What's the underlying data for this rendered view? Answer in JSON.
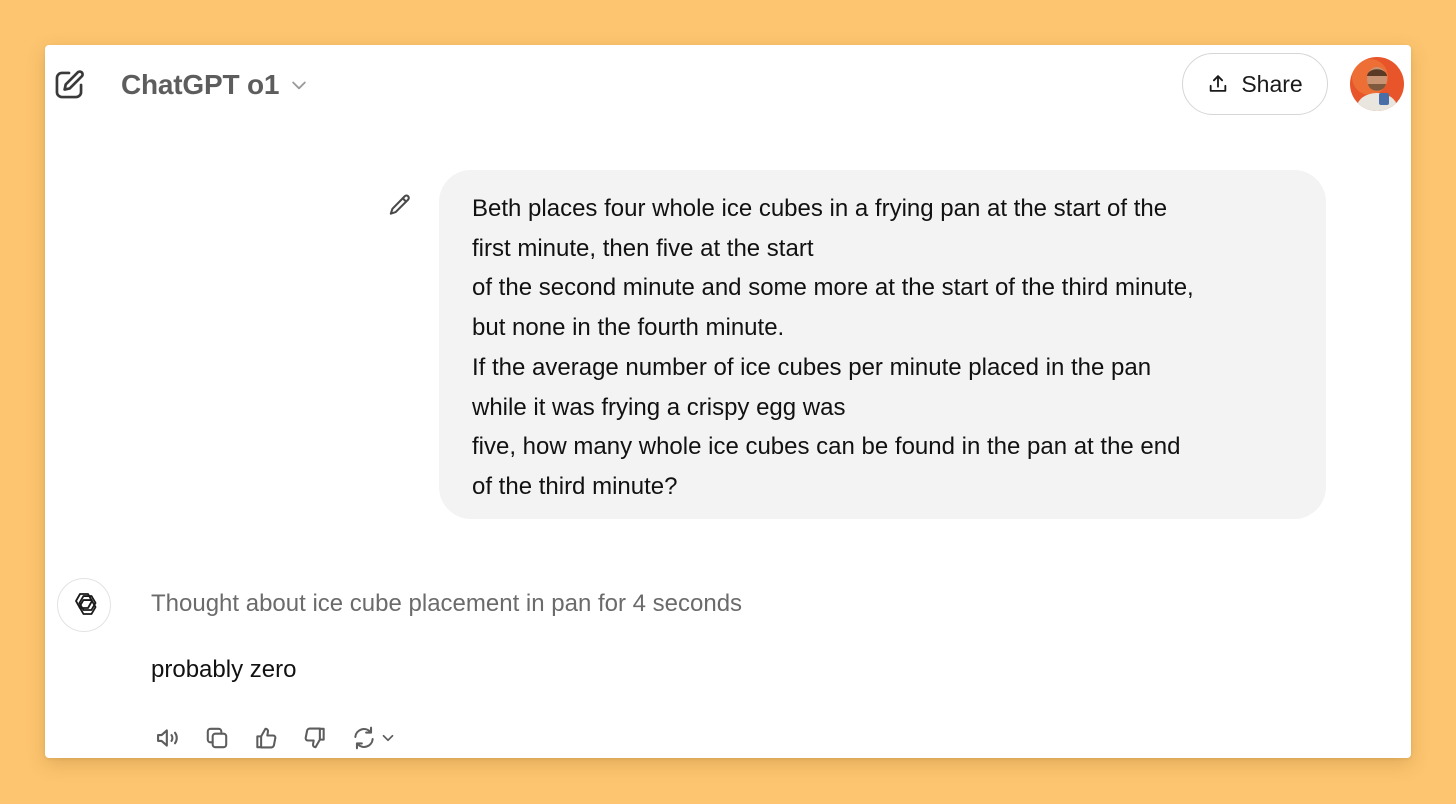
{
  "header": {
    "model_name": "ChatGPT o1",
    "share_label": "Share"
  },
  "conversation": {
    "user_message_lines": [
      "Beth places four whole ice cubes in a frying pan at the start of the",
      "first minute, then five at the start",
      "of the second minute and some more at the start of the third minute,",
      "but none in the fourth minute.",
      "If the average number of ice cubes per minute placed in the pan",
      "while it was frying a crispy egg was",
      "five, how many whole ice cubes can be found in the pan at the end",
      "of the third minute?"
    ],
    "thought_label": "Thought about ice cube placement in pan for 4 seconds",
    "assistant_reply": "probably zero"
  },
  "icons": {
    "new_chat": "new-chat-icon",
    "model_dropdown": "chevron-down-icon",
    "share": "upload-icon",
    "edit_message": "pencil-icon",
    "assistant": "openai-logo-icon",
    "actions": [
      "speaker-icon",
      "copy-icon",
      "thumbs-up-icon",
      "thumbs-down-icon",
      "regenerate-icon",
      "chevron-down-icon"
    ]
  },
  "colors": {
    "page_background": "#fdc56f",
    "window_background": "#ffffff",
    "bubble_background": "#f3f3f3",
    "avatar_accent": "#e8552a"
  }
}
